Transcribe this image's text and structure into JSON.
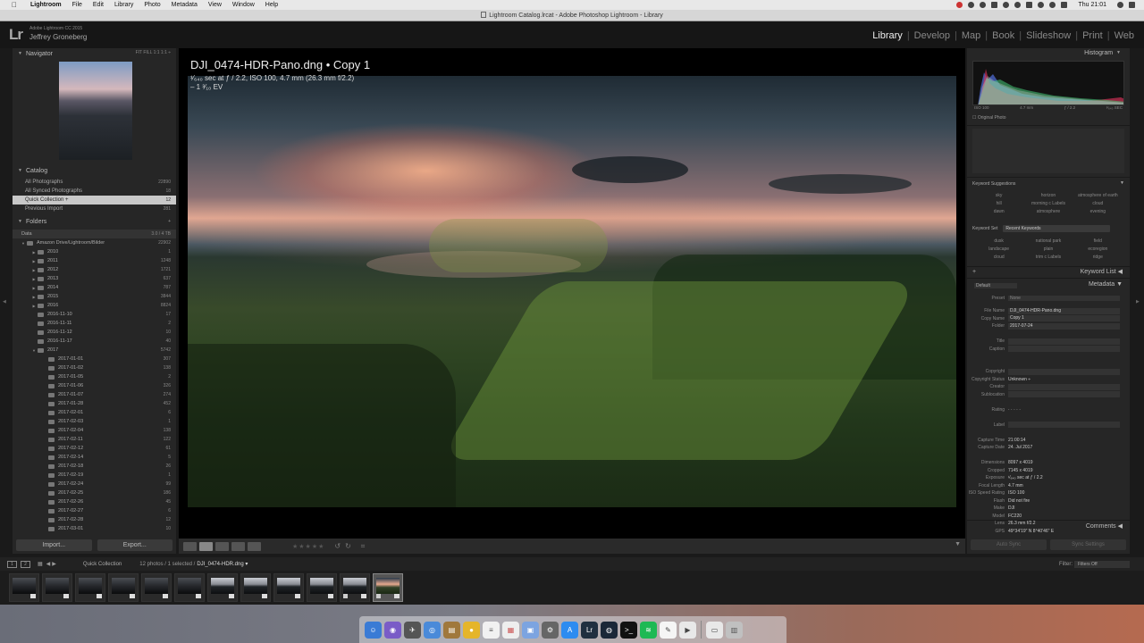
{
  "menubar": {
    "apple": "",
    "items": [
      "Lightroom",
      "File",
      "Edit",
      "Library",
      "Photo",
      "Metadata",
      "View",
      "Window",
      "Help"
    ],
    "clock": "Thu 21:01"
  },
  "window": {
    "title": "Lightroom Catalog.lrcat - Adobe Photoshop Lightroom - Library"
  },
  "identity": {
    "logo": "Lr",
    "product": "Adobe Lightroom CC 2015",
    "user": "Jeffrey Groneberg"
  },
  "modules": [
    "Library",
    "Develop",
    "Map",
    "Book",
    "Slideshow",
    "Print",
    "Web"
  ],
  "navigator": {
    "title": "Navigator",
    "modes": "FIT  FILL  1:1  1:1 ÷"
  },
  "catalog": {
    "title": "Catalog",
    "items": [
      {
        "label": "All Photographs",
        "count": "22890"
      },
      {
        "label": "All Synced Photographs",
        "count": "18"
      },
      {
        "label": "Quick Collection +",
        "count": "12"
      },
      {
        "label": "Previous Import",
        "count": "281"
      }
    ]
  },
  "folders": {
    "title": "Folders",
    "volume": {
      "label": "Data",
      "count": "3.0 / 4 TB"
    },
    "root": {
      "label": "Amazon Drive/Lightroom/Bilder",
      "count": "22902"
    },
    "years": [
      {
        "label": "2010",
        "count": "1"
      },
      {
        "label": "2011",
        "count": "1248"
      },
      {
        "label": "2012",
        "count": "1721"
      },
      {
        "label": "2013",
        "count": "637"
      },
      {
        "label": "2014",
        "count": "787"
      },
      {
        "label": "2015",
        "count": "3844"
      },
      {
        "label": "2016",
        "count": "8824"
      },
      {
        "label": "2016-11-10",
        "count": "17"
      },
      {
        "label": "2016-11-11",
        "count": "2"
      },
      {
        "label": "2016-11-12",
        "count": "10"
      },
      {
        "label": "2016-11-17",
        "count": "40"
      },
      {
        "label": "2017",
        "count": "5742"
      }
    ],
    "days": [
      {
        "label": "2017-01-01",
        "count": "307"
      },
      {
        "label": "2017-01-02",
        "count": "138"
      },
      {
        "label": "2017-01-05",
        "count": "2"
      },
      {
        "label": "2017-01-06",
        "count": "326"
      },
      {
        "label": "2017-01-07",
        "count": "274"
      },
      {
        "label": "2017-01-28",
        "count": "452"
      },
      {
        "label": "2017-02-01",
        "count": "6"
      },
      {
        "label": "2017-02-03",
        "count": "1"
      },
      {
        "label": "2017-02-04",
        "count": "138"
      },
      {
        "label": "2017-02-11",
        "count": "122"
      },
      {
        "label": "2017-02-12",
        "count": "61"
      },
      {
        "label": "2017-02-14",
        "count": "5"
      },
      {
        "label": "2017-02-18",
        "count": "26"
      },
      {
        "label": "2017-02-19",
        "count": "1"
      },
      {
        "label": "2017-02-24",
        "count": "99"
      },
      {
        "label": "2017-02-25",
        "count": "186"
      },
      {
        "label": "2017-02-26",
        "count": "45"
      },
      {
        "label": "2017-02-27",
        "count": "6"
      },
      {
        "label": "2017-02-28",
        "count": "12"
      },
      {
        "label": "2017-03-01",
        "count": "10"
      }
    ]
  },
  "leftbuttons": {
    "import": "Import...",
    "export": "Export..."
  },
  "loupe": {
    "title": "DJI_0474-HDR-Pano.dng  •  Copy 1",
    "line1": "¹⁄₆₄₀ sec at ƒ / 2.2, ISO 100, 4.7 mm (26.3 mm f/2.2)",
    "line2": "– 1 ³⁄₁₀ EV"
  },
  "toolbar": {
    "stars": "★★★★★"
  },
  "histogram": {
    "title": "Histogram",
    "iso": "ISO 100",
    "focal": "4.7 mm",
    "aperture": "ƒ / 2.2",
    "shutter": "¹⁄₆₄₀ SEC",
    "original": "Original Photo"
  },
  "keywords": {
    "suggestions_title": "Keyword Suggestions",
    "suggestions": [
      "sky",
      "horizon",
      "atmosphere of earth",
      "hill",
      "morning c Labels",
      "cloud",
      "dawn",
      "atmosphere",
      "evening"
    ],
    "set_label": "Keyword Set",
    "set_value": "Recent Keywords",
    "set_items": [
      "dusk",
      "national park",
      "field",
      "landscape",
      "plain",
      "ecoregion",
      "cloud",
      "trim c Labels",
      "ridge"
    ],
    "list_title": "Keyword List"
  },
  "metadata": {
    "title": "Metadata",
    "default": "Default",
    "preset_label": "Preset",
    "preset_value": "None",
    "rows": [
      {
        "k": "File Name",
        "v": "DJI_0474-HDR-Pano.dng",
        "box": true
      },
      {
        "k": "Copy Name",
        "v": "Copy 1",
        "box": true
      },
      {
        "k": "Folder",
        "v": "2017-07-24",
        "box": true
      },
      {
        "k": "",
        "v": "",
        "box": false
      },
      {
        "k": "Title",
        "v": "",
        "box": true
      },
      {
        "k": "Caption",
        "v": "",
        "box": true
      },
      {
        "k": "",
        "v": "",
        "box": false
      },
      {
        "k": "",
        "v": "",
        "box": false
      },
      {
        "k": "Copyright",
        "v": "",
        "box": true
      },
      {
        "k": "Copyright Status",
        "v": "Unknown ÷",
        "box": false
      },
      {
        "k": "Creator",
        "v": "",
        "box": true
      },
      {
        "k": "Sublocation",
        "v": "",
        "box": true
      },
      {
        "k": "",
        "v": "",
        "box": false
      },
      {
        "k": "Rating",
        "v": "·  ·  ·  ·  ·",
        "box": false
      },
      {
        "k": "",
        "v": "",
        "box": false
      },
      {
        "k": "Label",
        "v": "",
        "box": true
      },
      {
        "k": "",
        "v": "",
        "box": false
      },
      {
        "k": "Capture Time",
        "v": "21:00:14",
        "box": false
      },
      {
        "k": "Capture Date",
        "v": "24. Jul 2017",
        "box": false
      },
      {
        "k": "",
        "v": "",
        "box": false
      },
      {
        "k": "Dimensions",
        "v": "8097 x 4019",
        "box": false
      },
      {
        "k": "Cropped",
        "v": "7145 x 4019",
        "box": false
      },
      {
        "k": "Exposure",
        "v": "¹⁄₆₄₀ sec at ƒ / 2.2",
        "box": false
      },
      {
        "k": "Focal Length",
        "v": "4.7 mm",
        "box": false
      },
      {
        "k": "ISO Speed Rating",
        "v": "ISO 100",
        "box": false
      },
      {
        "k": "Flash",
        "v": "Did not fire",
        "box": false
      },
      {
        "k": "Make",
        "v": "DJI",
        "box": false
      },
      {
        "k": "Model",
        "v": "FC220",
        "box": false
      },
      {
        "k": "Lens",
        "v": "26.3 mm f/2.2",
        "box": false
      },
      {
        "k": "GPS",
        "v": "49°34'19\" N 8°40'46\" E",
        "box": false
      }
    ],
    "comments": "Comments"
  },
  "rightbuttons": {
    "autosync": "Auto Sync",
    "sync": "Sync Settings"
  },
  "filmbar": {
    "page1": "1",
    "page2": "2",
    "source": "Quick Collection",
    "info": "12 photos / 1 selected /",
    "selected_file": "DJI_0474-HDR.dng ▾",
    "filter_label": "Filter:",
    "filter_value": "Filters Off"
  },
  "filmstrip": {
    "count": 12,
    "selected_index": 11
  }
}
